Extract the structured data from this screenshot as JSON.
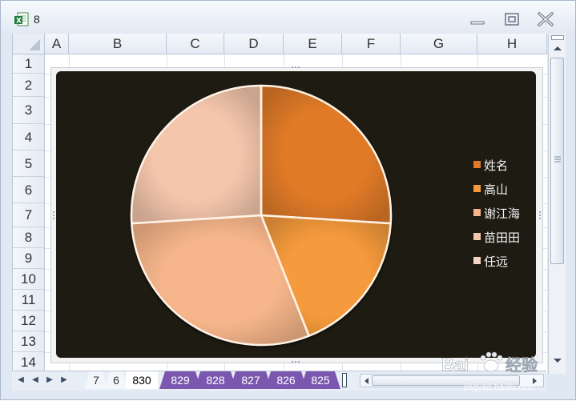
{
  "window": {
    "title": "8"
  },
  "columns": [
    "A",
    "B",
    "C",
    "D",
    "E",
    "F",
    "G",
    "H"
  ],
  "rows": [
    "1",
    "2",
    "3",
    "4",
    "5",
    "6",
    "7",
    "8",
    "9",
    "10",
    "11",
    "12",
    "13",
    "14"
  ],
  "chart_data": {
    "type": "pie",
    "title": "",
    "categories": [
      "姓名",
      "高山",
      "谢江海",
      "苗田田",
      "任远"
    ],
    "values": [
      26,
      18,
      30,
      26,
      0
    ],
    "background": "#1e1b12",
    "colors": [
      "#e07a28",
      "#f59a3c",
      "#f6b58a",
      "#f4c6ac",
      "#f3d3c4"
    ],
    "legend": "right",
    "style": "3D bevel"
  },
  "sheet_tabs": [
    {
      "label": "7",
      "style": "plain"
    },
    {
      "label": "6",
      "style": "plain"
    },
    {
      "label": "830",
      "style": "active"
    },
    {
      "label": "829",
      "style": "purple"
    },
    {
      "label": "828",
      "style": "purple"
    },
    {
      "label": "827",
      "style": "purple"
    },
    {
      "label": "826",
      "style": "purple"
    },
    {
      "label": "825",
      "style": "purple"
    }
  ],
  "watermark": {
    "text": "Baidu 经验",
    "url_text": "jingyan.baidu.com"
  }
}
